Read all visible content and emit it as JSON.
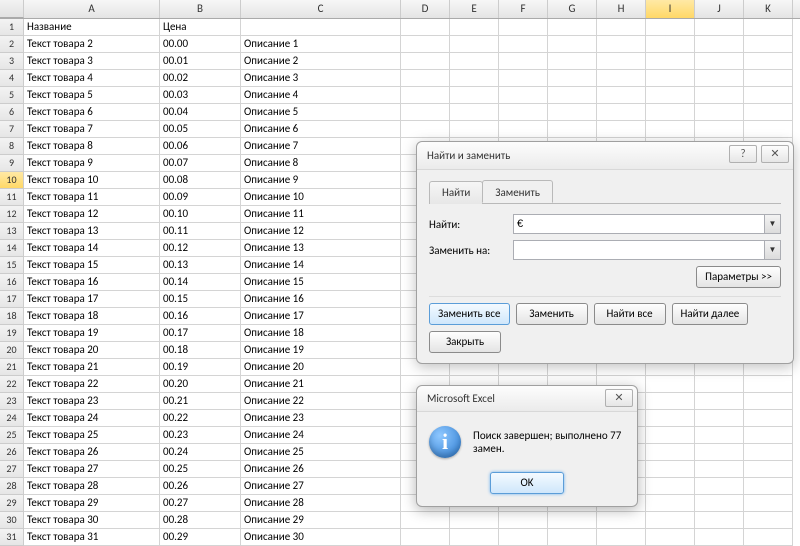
{
  "columns": [
    "A",
    "B",
    "C",
    "D",
    "E",
    "F",
    "G",
    "H",
    "I",
    "J",
    "K"
  ],
  "selected_col": "I",
  "selected_row": 10,
  "headers": {
    "A": "Название",
    "B": "Цена"
  },
  "rows": [
    {
      "n": 1,
      "a": "Название",
      "b": "Цена",
      "c": ""
    },
    {
      "n": 2,
      "a": "Текст товара 2",
      "b": "00.00",
      "c": "Описание 1"
    },
    {
      "n": 3,
      "a": "Текст товара 3",
      "b": "00.01",
      "c": "Описание 2"
    },
    {
      "n": 4,
      "a": "Текст товара 4",
      "b": "00.02",
      "c": "Описание 3"
    },
    {
      "n": 5,
      "a": "Текст товара 5",
      "b": "00.03",
      "c": "Описание 4"
    },
    {
      "n": 6,
      "a": "Текст товара 6",
      "b": "00.04",
      "c": "Описание 5"
    },
    {
      "n": 7,
      "a": "Текст товара 7",
      "b": "00.05",
      "c": "Описание 6"
    },
    {
      "n": 8,
      "a": "Текст товара 8",
      "b": "00.06",
      "c": "Описание 7"
    },
    {
      "n": 9,
      "a": "Текст товара 9",
      "b": "00.07",
      "c": "Описание 8"
    },
    {
      "n": 10,
      "a": "Текст товара 10",
      "b": "00.08",
      "c": "Описание 9"
    },
    {
      "n": 11,
      "a": "Текст товара 11",
      "b": "00.09",
      "c": "Описание 10"
    },
    {
      "n": 12,
      "a": "Текст товара 12",
      "b": "00.10",
      "c": "Описание 11"
    },
    {
      "n": 13,
      "a": "Текст товара 13",
      "b": "00.11",
      "c": "Описание 12"
    },
    {
      "n": 14,
      "a": "Текст товара 14",
      "b": "00.12",
      "c": "Описание 13"
    },
    {
      "n": 15,
      "a": "Текст товара 15",
      "b": "00.13",
      "c": "Описание 14"
    },
    {
      "n": 16,
      "a": "Текст товара 16",
      "b": "00.14",
      "c": "Описание 15"
    },
    {
      "n": 17,
      "a": "Текст товара 17",
      "b": "00.15",
      "c": "Описание 16"
    },
    {
      "n": 18,
      "a": "Текст товара 18",
      "b": "00.16",
      "c": "Описание 17"
    },
    {
      "n": 19,
      "a": "Текст товара 19",
      "b": "00.17",
      "c": "Описание 18"
    },
    {
      "n": 20,
      "a": "Текст товара 20",
      "b": "00.18",
      "c": "Описание 19"
    },
    {
      "n": 21,
      "a": "Текст товара 21",
      "b": "00.19",
      "c": "Описание 20"
    },
    {
      "n": 22,
      "a": "Текст товара 22",
      "b": "00.20",
      "c": "Описание 21"
    },
    {
      "n": 23,
      "a": "Текст товара 23",
      "b": "00.21",
      "c": "Описание 22"
    },
    {
      "n": 24,
      "a": "Текст товара 24",
      "b": "00.22",
      "c": "Описание 23"
    },
    {
      "n": 25,
      "a": "Текст товара 25",
      "b": "00.23",
      "c": "Описание 24"
    },
    {
      "n": 26,
      "a": "Текст товара 26",
      "b": "00.24",
      "c": "Описание 25"
    },
    {
      "n": 27,
      "a": "Текст товара 27",
      "b": "00.25",
      "c": "Описание 26"
    },
    {
      "n": 28,
      "a": "Текст товара 28",
      "b": "00.26",
      "c": "Описание 27"
    },
    {
      "n": 29,
      "a": "Текст товара 29",
      "b": "00.27",
      "c": "Описание 28"
    },
    {
      "n": 30,
      "a": "Текст товара 30",
      "b": "00.28",
      "c": "Описание 29"
    },
    {
      "n": 31,
      "a": "Текст товара 31",
      "b": "00.29",
      "c": "Описание 30"
    }
  ],
  "find_dialog": {
    "title": "Найти и заменить",
    "help_glyph": "?",
    "close_glyph": "✕",
    "tab_find": "Найти",
    "tab_replace": "Заменить",
    "find_label": "Найти:",
    "find_value": "€",
    "replace_label": "Заменить на:",
    "replace_value": "",
    "params_btn": "Параметры >>",
    "btn_replace_all": "Заменить все",
    "btn_replace": "Заменить",
    "btn_find_all": "Найти все",
    "btn_find_next": "Найти далее",
    "btn_close": "Закрыть"
  },
  "msg_dialog": {
    "title": "Microsoft Excel",
    "close_glyph": "✕",
    "icon_glyph": "i",
    "message": "Поиск завершен; выполнено 77 замен.",
    "ok": "OK"
  }
}
